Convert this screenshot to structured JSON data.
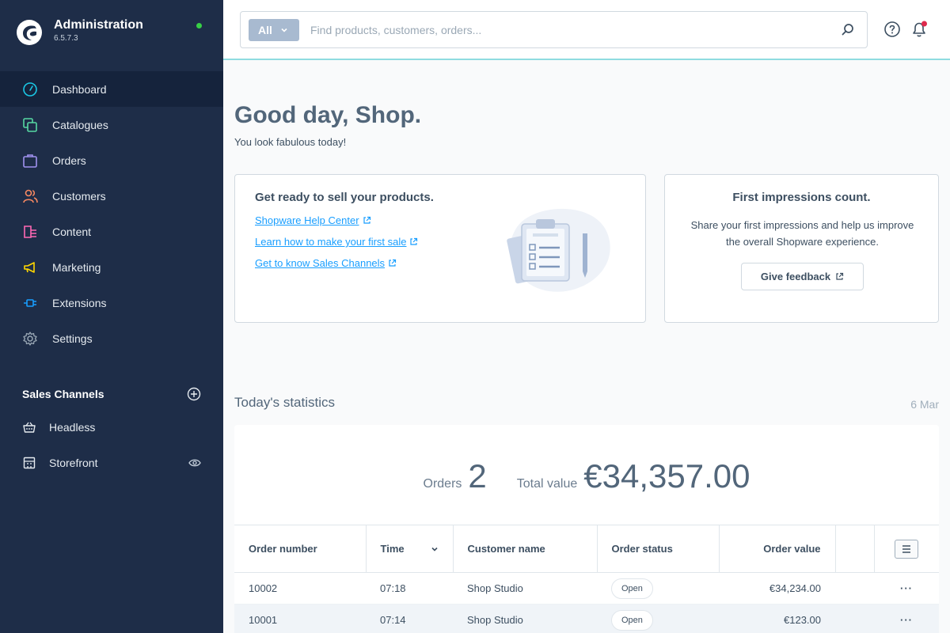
{
  "brand": {
    "title": "Administration",
    "version": "6.5.7.3",
    "status_color": "#37d046"
  },
  "sidebar": {
    "items": [
      {
        "label": "Dashboard",
        "icon": "gauge-icon",
        "color": "#1bc8e6",
        "active": true
      },
      {
        "label": "Catalogues",
        "icon": "catalogue-icon",
        "color": "#57d9a3",
        "active": false
      },
      {
        "label": "Orders",
        "icon": "bag-icon",
        "color": "#a092f0",
        "active": false
      },
      {
        "label": "Customers",
        "icon": "users-icon",
        "color": "#f88962",
        "active": false
      },
      {
        "label": "Content",
        "icon": "content-icon",
        "color": "#ff68b4",
        "active": false
      },
      {
        "label": "Marketing",
        "icon": "megaphone-icon",
        "color": "#ffd700",
        "active": false
      },
      {
        "label": "Extensions",
        "icon": "plug-icon",
        "color": "#189eff",
        "active": false
      },
      {
        "label": "Settings",
        "icon": "gear-icon",
        "color": "#9aa8b5",
        "active": false
      }
    ],
    "sales_channels": {
      "title": "Sales Channels",
      "items": [
        {
          "label": "Headless",
          "icon": "basket-icon"
        },
        {
          "label": "Storefront",
          "icon": "storefront-icon"
        }
      ]
    }
  },
  "search": {
    "type_label": "All",
    "placeholder": "Find products, customers, orders..."
  },
  "main": {
    "greeting": "Good day, Shop.",
    "subgreeting": "You look fabulous today!",
    "card_sell": {
      "title": "Get ready to sell your products.",
      "links": [
        "Shopware Help Center",
        "Learn how to make your first sale",
        "Get to know Sales Channels"
      ]
    },
    "card_feedback": {
      "title": "First impressions count.",
      "text": "Share your first impressions and help us improve the overall Shopware experience.",
      "button": "Give feedback"
    },
    "stats": {
      "title": "Today's statistics",
      "date": "6 Mar",
      "orders_label": "Orders",
      "orders_value": "2",
      "total_label": "Total value",
      "total_value": "€34,357.00",
      "columns": [
        "Order number",
        "Time",
        "Customer name",
        "Order status",
        "Order value"
      ],
      "rows": [
        {
          "number": "10002",
          "time": "07:18",
          "customer": "Shop Studio",
          "status": "Open",
          "value": "€34,234.00"
        },
        {
          "number": "10001",
          "time": "07:14",
          "customer": "Shop Studio",
          "status": "Open",
          "value": "€123.00"
        }
      ],
      "row_action": "···"
    }
  }
}
